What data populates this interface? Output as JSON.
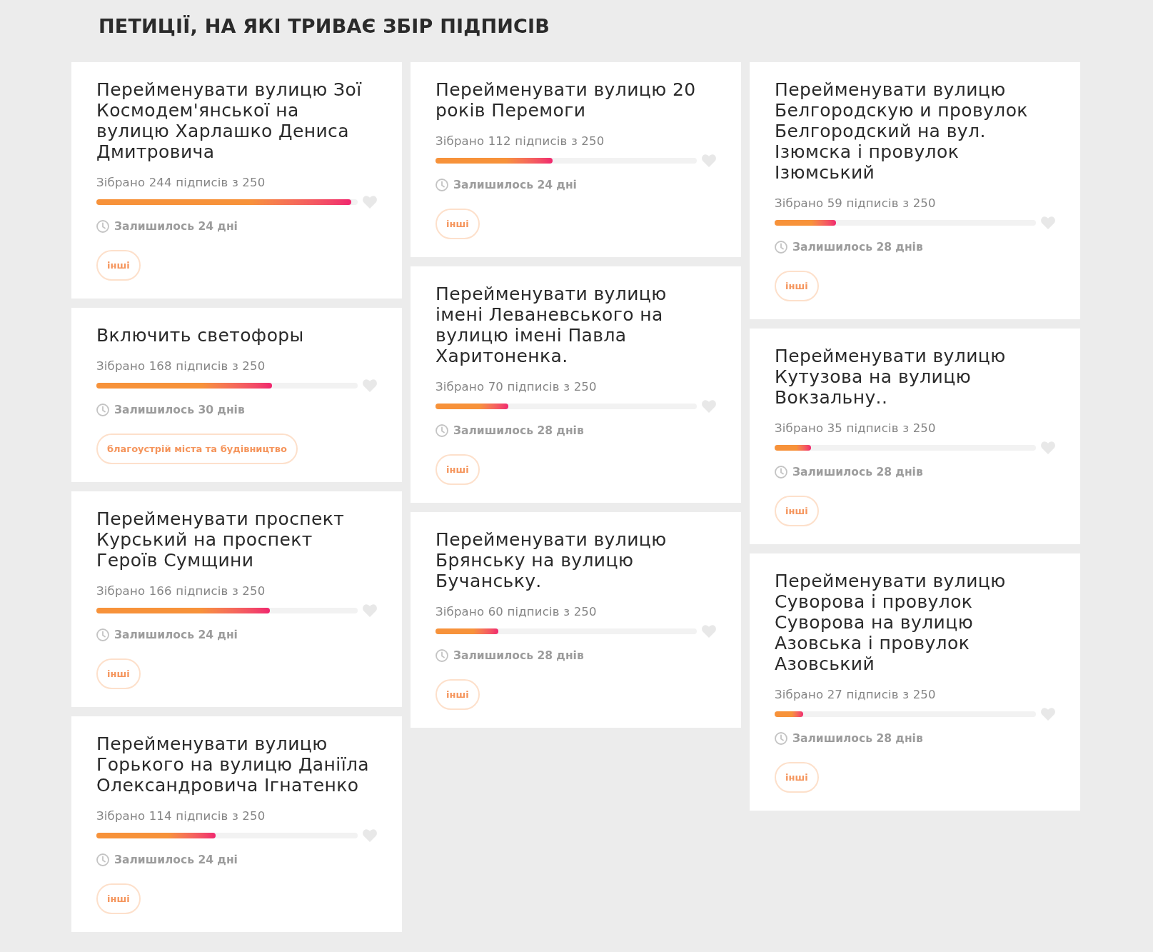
{
  "heading": "ПЕТИЦІЇ, НА ЯКІ ТРИВАЄ ЗБІР ПІДПИСІВ",
  "columns": [
    {
      "petitions": [
        {
          "title": "Перейменувати вулицю Зої Космодем'янської на вулицю Харлашко Дениса Дмитровича",
          "collected": "Зібрано 244 підписів з 250",
          "level": 0.976,
          "remaining": "Залишилось 24 дні",
          "tag": "інші"
        },
        {
          "title": "Включить светофоры",
          "collected": "Зібрано 168 підписів з 250",
          "level": 0.672,
          "remaining": "Залишилось 30 днів",
          "tag": "благоустрій міста та будівництво"
        },
        {
          "title": "Перейменувати проспект Курський на проспект Героїв Сумщини",
          "collected": "Зібрано 166 підписів з 250",
          "level": 0.664,
          "remaining": "Залишилось 24 дні",
          "tag": "інші"
        },
        {
          "title": "Перейменувати вулицю Горького на вулицю Даніїла Олександровича Ігнатенко",
          "collected": "Зібрано 114 підписів з 250",
          "level": 0.456,
          "remaining": "Залишилось 24 дні",
          "tag": "інші"
        }
      ]
    },
    {
      "petitions": [
        {
          "title": "Перейменувати вулицю 20 років Перемоги",
          "collected": "Зібрано 112 підписів з 250",
          "level": 0.448,
          "remaining": "Залишилось 24 дні",
          "tag": "інші"
        },
        {
          "title": "Перейменувати вулицю імені Леваневського на вулицю імені Павла Харитоненка.",
          "collected": "Зібрано 70 підписів з 250",
          "level": 0.28,
          "remaining": "Залишилось 28 днів",
          "tag": "інші"
        },
        {
          "title": "Перейменувати вулицю Брянську на вулицю Бучанську.",
          "collected": "Зібрано 60 підписів з 250",
          "level": 0.24,
          "remaining": "Залишилось 28 днів",
          "tag": "інші"
        }
      ]
    },
    {
      "petitions": [
        {
          "title": "Перейменувати вулицю Белгородскую и провулок Белгородский на вул. Ізюмска і провулок Ізюмський",
          "collected": "Зібрано 59 підписів з 250",
          "level": 0.236,
          "remaining": "Залишилось 28 днів",
          "tag": "інші"
        },
        {
          "title": "Перейменувати вулицю Кутузова на вулицю Вокзальну..",
          "collected": "Зібрано 35 підписів з 250",
          "level": 0.14,
          "remaining": "Залишилось 28 днів",
          "tag": "інші"
        },
        {
          "title": "Перейменувати вулицю Суворова і провулок Суворова на вулицю Азовська і провулок Азовський",
          "collected": "Зібрано 27 підписів з 250",
          "level": 0.108,
          "remaining": "Залишилось 28 днів",
          "tag": "інші"
        }
      ]
    }
  ]
}
